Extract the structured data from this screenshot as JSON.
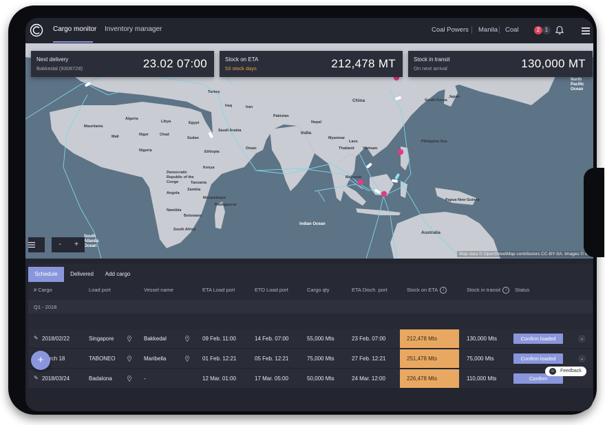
{
  "nav": {
    "tabs": [
      "Cargo monitor",
      "Inventory manager"
    ],
    "company": "Coal Powers",
    "location": "Manila",
    "commodity": "Coal",
    "alerts_red": "2",
    "alerts_gray": "1"
  },
  "cards": [
    {
      "title": "Next delivery",
      "sub": "Bakkedal (9308728)",
      "value": "23.02 07:00"
    },
    {
      "title": "Stock on ETA",
      "sub": "53 stock days",
      "value": "212,478 MT"
    },
    {
      "title": "Stock in transit",
      "sub": "On next arrival",
      "value": "130,000 MT"
    }
  ],
  "map": {
    "attribution": "Map data © OpenStreetMap contributors CC-BY-SA. Images © Ma",
    "zoom_out": "-",
    "zoom_in": "+",
    "labels": {
      "china": "China",
      "india": "India",
      "egypt": "Egypt",
      "libya": "Libya",
      "algeria": "Algeria",
      "saudi": "Saudi Arabia",
      "oman": "Oman",
      "sudan": "Sudan",
      "ethiopia": "Ethiopia",
      "mali": "Mali",
      "niger": "Niger",
      "chad": "Chad",
      "nigeria": "Nigeria",
      "drc": "Democratic Republic of the Congo",
      "tanzania": "Tanzania",
      "angola": "Angola",
      "namibia": "Namibia",
      "south_africa": "South Africa",
      "botswana": "Botswana",
      "madagascar": "Madagascar",
      "iran": "Iran",
      "pakistan": "Pakistan",
      "thailand": "Thailand",
      "philippines": "Philippine Sea",
      "malaysia": "Malaysia",
      "australia": "Australia",
      "indian_ocean": "Indian Ocean",
      "south_atlantic": "South Atlantic Ocean",
      "north_pacific": "North Pacific Ocean",
      "mauritania": "Mauritania",
      "kenya": "Kenya",
      "zambia": "Zambia",
      "mozambique": "Mozambique",
      "iraq": "Iraq",
      "turkey": "Turkey",
      "nepal": "Nepal",
      "myanmar": "Myanmar",
      "laos": "Laos",
      "vietnam": "Vietnam",
      "papua": "Papua New Guinea",
      "japan": "Japan",
      "south_korea": "South Korea"
    }
  },
  "schedule": {
    "tabs": [
      "Schedule",
      "Delivered",
      "Add cargo"
    ],
    "columns": [
      "# Cargo",
      "Load port",
      "Vessel name",
      "ETA Load port",
      "ETD Load port",
      "Cargo qty",
      "ETA Disch. port",
      "Stock on ETA",
      "Stock in transit",
      "Status"
    ],
    "group": "Q1 - 2018",
    "rows": [
      {
        "cargo": "2018/02/22",
        "load_port": "Singapore",
        "vessel": "Bakkedal",
        "eta_load": "09 Feb. 11:00",
        "etd_load": "14 Feb. 07:00",
        "qty": "55,000 Mts",
        "eta_disch": "23 Feb. 07:00",
        "stock_eta": "212,478 Mts",
        "stock_transit": "130,000 Mts",
        "status": "Confirm loaded"
      },
      {
        "cargo": "march 18",
        "load_port": "TABONEO",
        "vessel": "Maribella",
        "eta_load": "01 Feb. 12:21",
        "etd_load": "05 Feb. 12:21",
        "qty": "75,000 Mts",
        "eta_disch": "27 Feb. 12:21",
        "stock_eta": "251,478 Mts",
        "stock_transit": "75,000 Mts",
        "status": "Confirm loaded"
      },
      {
        "cargo": "2018/03/24",
        "load_port": "Badalona",
        "vessel": "-",
        "eta_load": "12 Mar. 01:00",
        "etd_load": "17 Mar. 05:00",
        "qty": "50,000 Mts",
        "eta_disch": "24 Mar. 12:00",
        "stock_eta": "226,478 Mts",
        "stock_transit": "110,000 Mts",
        "status": "Confirm"
      }
    ]
  },
  "fab": "+",
  "feedback": "Feedback",
  "colors": {
    "accent": "#8a96dc",
    "stock_highlight": "#e9a862",
    "alert": "#e0455a",
    "ship": "#e23b82"
  }
}
